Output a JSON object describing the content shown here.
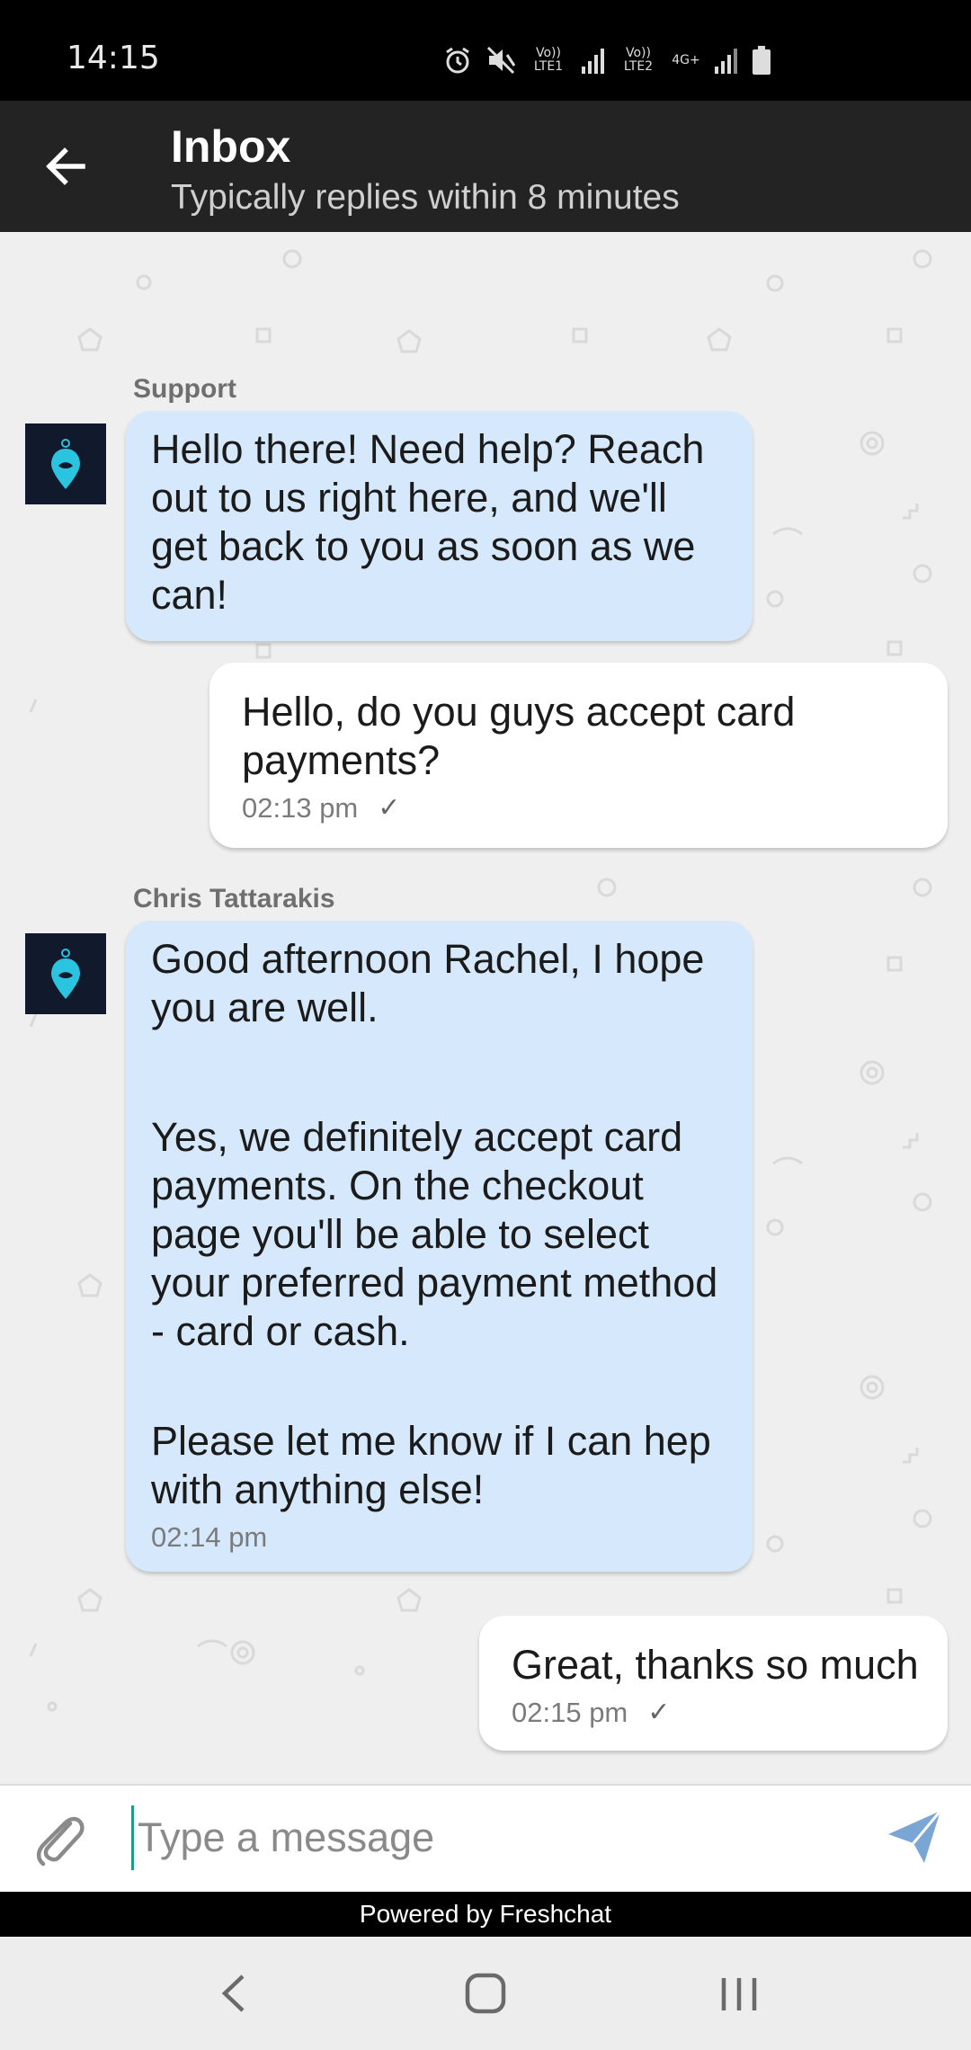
{
  "status_bar": {
    "time": "14:15",
    "sim1_label": "Vo)) LTE1",
    "sim2_label": "Vo)) LTE2",
    "sim2_net": "4G+",
    "icons": [
      "alarm-icon",
      "mute-icon",
      "signal-icon",
      "battery-icon"
    ]
  },
  "header": {
    "title": "Inbox",
    "subtitle": "Typically replies within 8 minutes",
    "back_icon": "arrow-left-icon"
  },
  "messages": [
    {
      "direction": "in",
      "sender": "Support",
      "paragraphs": [
        "Hello there! Need help? Reach out to us right here, and we'll get back to you as soon as we can!"
      ],
      "time": ""
    },
    {
      "direction": "out",
      "paragraphs": [
        "Hello, do you guys accept card payments?"
      ],
      "time": "02:13 pm",
      "check": "✓"
    },
    {
      "direction": "in",
      "sender": "Chris Tattarakis",
      "paragraphs": [
        "Good afternoon Rachel, I hope you are well.",
        "Yes, we definitely accept card payments. On the checkout page you'll be able to select your preferred payment method - card or cash.",
        "Please let me know if I can hep with anything else!"
      ],
      "time": "02:14 pm"
    },
    {
      "direction": "out",
      "paragraphs": [
        "Great, thanks so much"
      ],
      "time": "02:15 pm",
      "check": "✓"
    }
  ],
  "composer": {
    "placeholder": "Type a message",
    "attach_icon": "paperclip-icon",
    "send_icon": "send-icon"
  },
  "footer": {
    "powered_by": "Powered by Freshchat"
  },
  "nav": {
    "back": "nav-back-icon",
    "home": "nav-home-icon",
    "recents": "nav-recents-icon"
  },
  "colors": {
    "incoming_bubble": "#d6e8fb",
    "outgoing_bubble": "#ffffff",
    "app_bar": "#232323",
    "send_icon": "#7aa6d6",
    "cursor": "#1aa08a"
  }
}
